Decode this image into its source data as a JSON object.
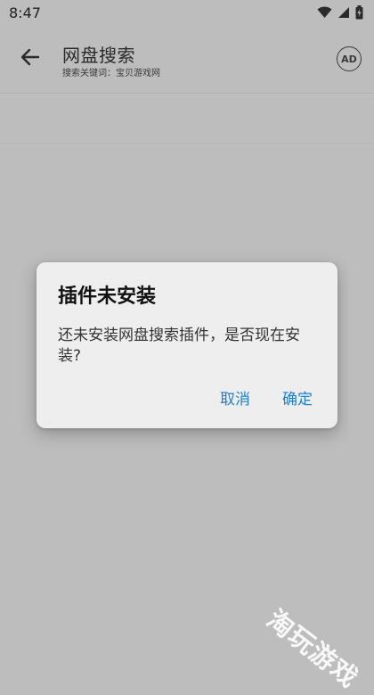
{
  "status_bar": {
    "time": "8:47",
    "icons": [
      "wifi-icon",
      "signal-icon",
      "battery-icon"
    ]
  },
  "toolbar": {
    "title": "网盘搜索",
    "subtitle": "搜索关键词：宝贝游戏网",
    "ad_label": "AD",
    "back_icon": "arrow-left-icon"
  },
  "dialog": {
    "title": "插件未安装",
    "message": "还未安装网盘搜索插件，是否现在安装?",
    "cancel_label": "取消",
    "confirm_label": "确定"
  },
  "watermark": {
    "text": "淘玩游戏"
  },
  "colors": {
    "accent": "#1f7fcf",
    "dim_background": "#bdbdbd",
    "dialog_background": "#eeeeee"
  }
}
